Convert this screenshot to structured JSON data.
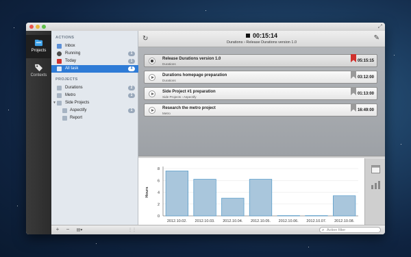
{
  "tabs": [
    {
      "label": "Projects",
      "icon": "projects-icon",
      "active": true
    },
    {
      "label": "Contexts",
      "icon": "tag-icon",
      "active": false
    }
  ],
  "sidebar": {
    "actions_header": "ACTIONS",
    "actions": [
      {
        "label": "Inbox",
        "icon": "inbox-icon",
        "badge": ""
      },
      {
        "label": "Running",
        "icon": "running-icon",
        "badge": "1"
      },
      {
        "label": "Today",
        "icon": "today-icon",
        "badge": "1"
      },
      {
        "label": "All task",
        "icon": "all-tasks-icon",
        "badge": "4",
        "selected": true
      }
    ],
    "projects_header": "PROJECTS",
    "projects": [
      {
        "label": "Durations",
        "badge": "2"
      },
      {
        "label": "Metro",
        "badge": "1"
      },
      {
        "label": "Side Projects",
        "badge": ""
      },
      {
        "label": "Aspectify",
        "badge": "1"
      },
      {
        "label": "Report",
        "badge": ""
      }
    ]
  },
  "header": {
    "timer": "00:15:14",
    "subtitle": "Durations › Release Durations version 1.0"
  },
  "tasks": [
    {
      "name": "Release Durations version 1.0",
      "path": "Durations",
      "time": "05:15:15",
      "flag_color": "#d0312d",
      "running": true
    },
    {
      "name": "Durations homepage preparation",
      "path": "Durations",
      "time": "03:12:00",
      "flag_color": "#9a9a9a",
      "running": false
    },
    {
      "name": "Side Project #1 preparation",
      "path": "Side Projects › Aspectify",
      "time": "01:13:00",
      "flag_color": "#9a9a9a",
      "running": false
    },
    {
      "name": "Research the metro project",
      "path": "Metro",
      "time": "16:49:00",
      "flag_color": "#9a9a9a",
      "running": false
    }
  ],
  "filter": {
    "placeholder": "Action filter"
  },
  "colors": {
    "bar_fill": "#a9c6dc",
    "bar_stroke": "#4f97c7",
    "selection": "#2e7bd6"
  },
  "chart_data": {
    "type": "bar",
    "categories": [
      "2012.10.02.",
      "2012.10.03.",
      "2012.10.04.",
      "2012.10.05.",
      "2012.10.06.",
      "2012.10.07.",
      "2012.10.08."
    ],
    "values": [
      7.6,
      6.2,
      3.0,
      6.2,
      0.05,
      0.05,
      3.4
    ],
    "ylabel": "Hours",
    "yticks": [
      "0",
      "2",
      "4",
      "6",
      "8"
    ],
    "ylim": [
      0,
      8
    ]
  }
}
